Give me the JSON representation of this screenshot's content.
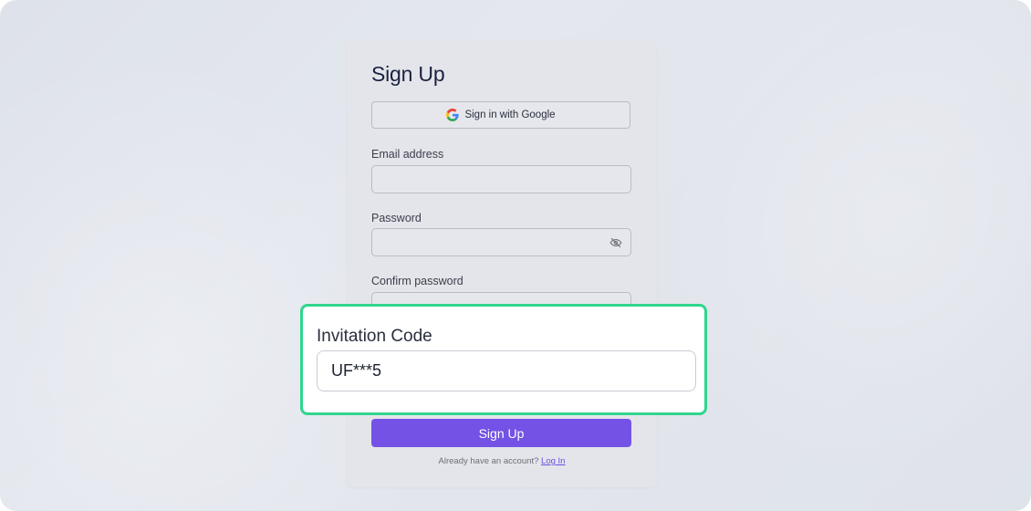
{
  "card": {
    "title": "Sign Up",
    "google_button_label": "Sign in with Google",
    "email_label": "Email address",
    "password_label": "Password",
    "confirm_password_label": "Confirm password",
    "signup_button_label": "Sign Up",
    "login_prompt": "Already have an account?",
    "login_link": "Log In"
  },
  "highlight": {
    "label": "Invitation Code",
    "value": "UF***5"
  },
  "icons": {
    "google": "google-icon",
    "password_toggle": "eye-off-icon"
  },
  "colors": {
    "primary": "#7452e6",
    "highlight_border": "#2fd68c",
    "link": "#6a4fe0"
  }
}
